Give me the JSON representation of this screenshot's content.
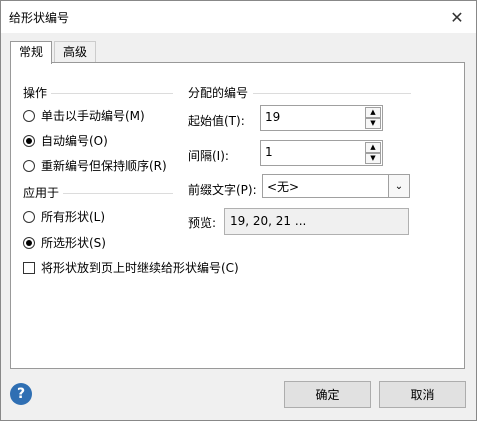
{
  "window": {
    "title": "给形状编号"
  },
  "tabs": [
    {
      "label": "常规"
    },
    {
      "label": "高级"
    }
  ],
  "operation": {
    "title": "操作",
    "options": [
      {
        "label": "单击以手动编号(M)",
        "checked": false
      },
      {
        "label": "自动编号(O)",
        "checked": true
      },
      {
        "label": "重新编号但保持顺序(R)",
        "checked": false
      }
    ]
  },
  "apply_to": {
    "title": "应用于",
    "options": [
      {
        "label": "所有形状(L)",
        "checked": false
      },
      {
        "label": "所选形状(S)",
        "checked": true
      }
    ]
  },
  "continue_checkbox": {
    "label": "将形状放到页上时继续给形状编号(C)",
    "checked": false
  },
  "numbering": {
    "title": "分配的编号",
    "start_label": "起始值(T):",
    "start_value": "19",
    "interval_label": "间隔(I):",
    "interval_value": "1",
    "prefix_label": "前缀文字(P):",
    "prefix_value": "<无>",
    "preview_label": "预览:",
    "preview_value": "19, 20, 21 ..."
  },
  "buttons": {
    "ok": "确定",
    "cancel": "取消"
  },
  "colors": {
    "help_icon": "#2f6fb3"
  }
}
